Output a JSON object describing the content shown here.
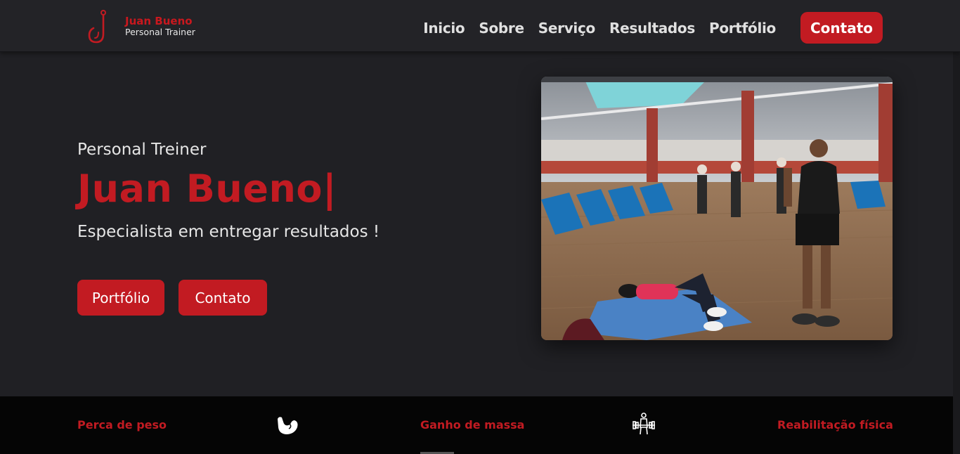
{
  "logo": {
    "name": "Juan Bueno",
    "subtitle": "Personal Trainer"
  },
  "nav": {
    "items": [
      "Inicio",
      "Sobre",
      "Serviço",
      "Resultados",
      "Portfólio"
    ],
    "cta": "Contato"
  },
  "hero": {
    "kicker": "Personal Treiner",
    "name": "Juan Bueno|",
    "tagline": "Especialista em entregar resultados !",
    "buttons": {
      "portfolio": "Portfólio",
      "contact": "Contato"
    }
  },
  "services": [
    {
      "label": "Perca de peso"
    },
    {
      "label": "Ganho de massa"
    },
    {
      "label": "Reabilitação física"
    }
  ],
  "colors": {
    "accent": "#c21b22",
    "background": "#202024",
    "header": "#232327",
    "strip": "#050505"
  }
}
